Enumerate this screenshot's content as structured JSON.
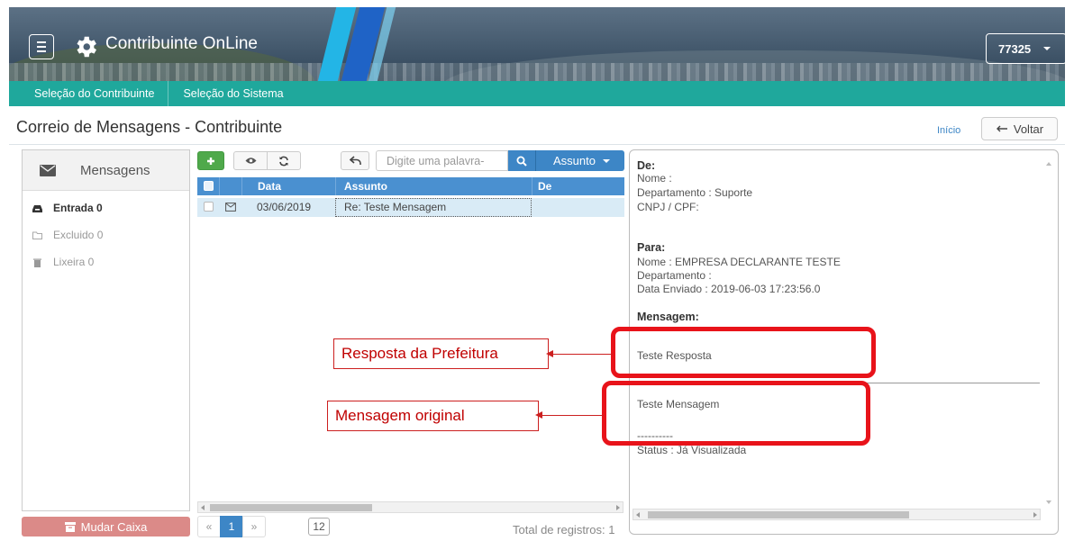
{
  "header": {
    "app_title": "Contribuinte OnLine",
    "user_code": "77325"
  },
  "navbar": {
    "items": [
      "Seleção do Contribuinte",
      "Seleção do Sistema"
    ]
  },
  "page": {
    "title": "Correio de Mensagens - Contribuinte",
    "home_link": "Início",
    "back_label": "Voltar"
  },
  "folders": {
    "header": "Mensagens",
    "items": [
      {
        "label": "Entrada 0",
        "icon": "inbox-icon",
        "active": true
      },
      {
        "label": "Excluido 0",
        "icon": "folder-icon",
        "active": false
      },
      {
        "label": "Lixeira 0",
        "icon": "trash-icon",
        "active": false
      }
    ],
    "change_box_label": "Mudar Caixa"
  },
  "toolbar": {
    "new_icon": "plus-icon",
    "view_icon": "eye-icon",
    "refresh_icon": "refresh-icon",
    "reply_icon": "reply-icon",
    "search_placeholder": "Digite uma palavra-",
    "search_icon": "search-icon",
    "subject_filter": "Assunto"
  },
  "grid": {
    "columns": [
      "Data",
      "Assunto",
      "De"
    ],
    "rows": [
      {
        "date": "03/06/2019",
        "subject": "Re: Teste Mensagem",
        "from": ""
      }
    ]
  },
  "pagination": {
    "first": "«",
    "current": "1",
    "last": "»",
    "page_size": "12",
    "total": "Total de registros: 1"
  },
  "detail": {
    "from_heading": "De:",
    "from_name": "Nome :",
    "from_department": "Departamento : Suporte",
    "from_cnpj": "CNPJ / CPF:",
    "to_heading": "Para:",
    "to_name": "Nome : EMPRESA DECLARANTE TESTE",
    "to_department": "Departamento :",
    "sent_date": "Data Enviado : 2019-06-03 17:23:56.0",
    "message_heading": "Mensagem:",
    "reply_text": "Teste Resposta",
    "original_text": "Teste Mensagem",
    "separator": "----------",
    "status": "Status : Já Visualizada"
  },
  "annotations": {
    "reply_label": "Resposta da Prefeitura",
    "original_label": "Mensagem original"
  },
  "colors": {
    "nav_teal": "#1fa89c",
    "primary_blue": "#3d86c6",
    "grid_header": "#4a90d0",
    "success_green": "#4fa94b",
    "danger_light": "#db8a88",
    "annotation_red": "#e8131a"
  }
}
